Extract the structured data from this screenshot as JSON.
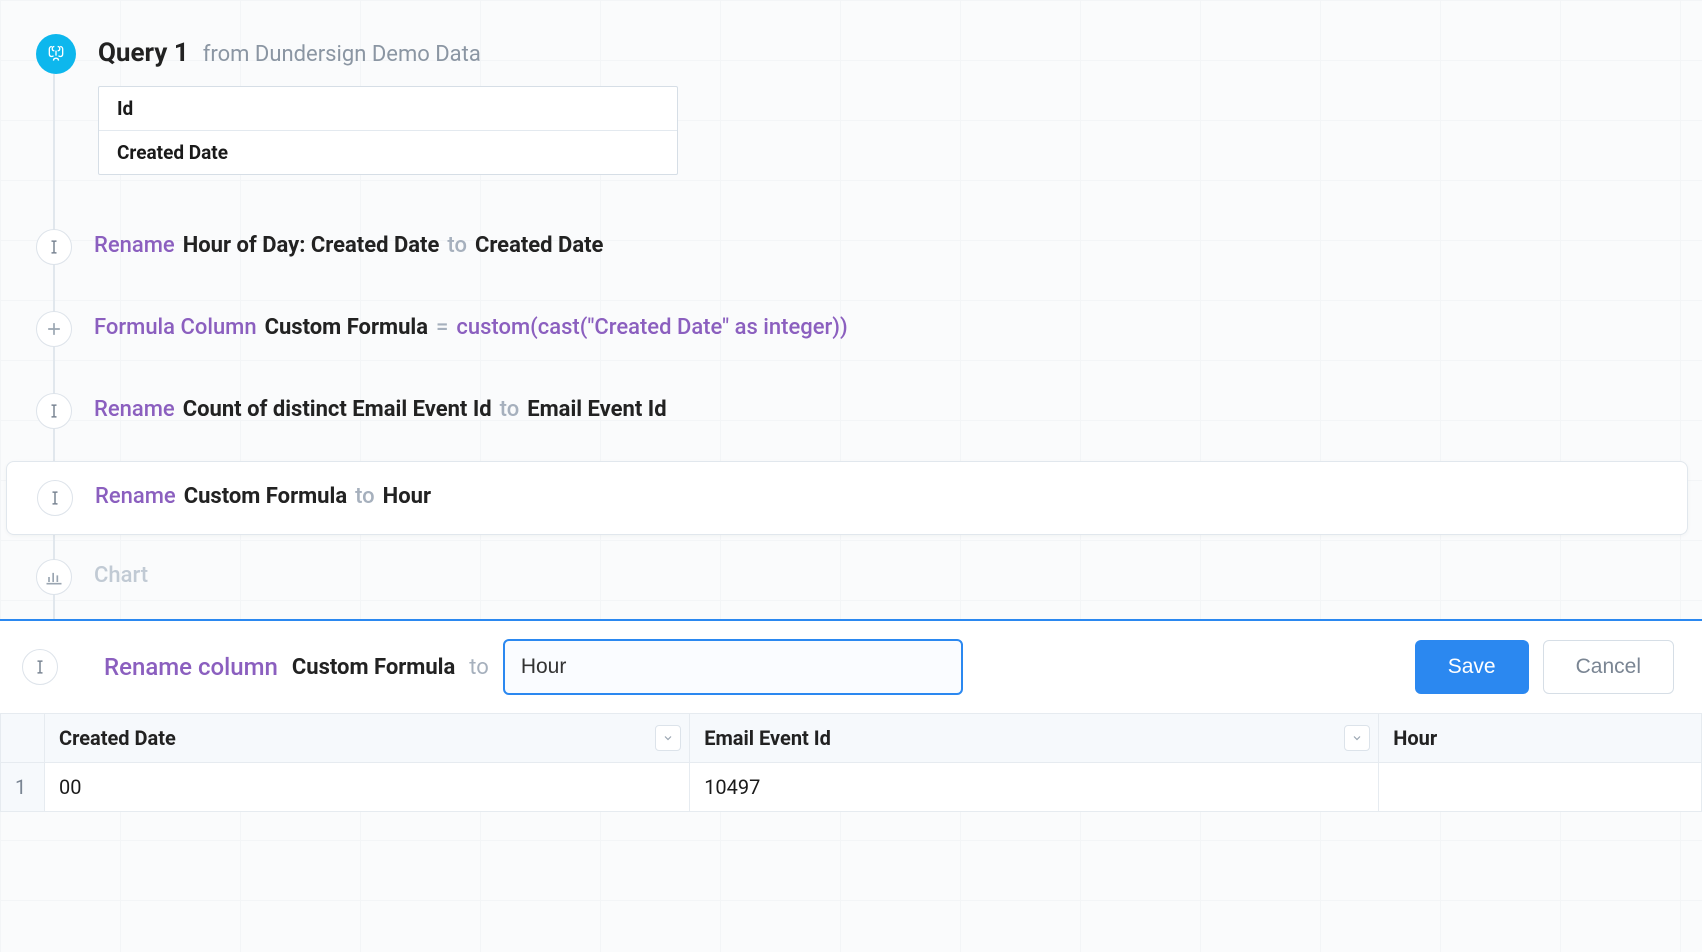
{
  "header": {
    "title": "Query 1",
    "source_label": "from Dundersign Demo Data",
    "columns": [
      "Id",
      "Created Date"
    ]
  },
  "steps": [
    {
      "kind": "rename",
      "label": "Rename",
      "from": "Hour of Day: Created Date",
      "joiner": "to",
      "to": "Created Date"
    },
    {
      "kind": "formula",
      "label": "Formula Column",
      "col_name": "Custom Formula",
      "eq": "=",
      "expr": "custom(cast(\"Created Date\" as integer))"
    },
    {
      "kind": "rename",
      "label": "Rename",
      "from": "Count of distinct Email Event Id",
      "joiner": "to",
      "to": "Email Event Id"
    },
    {
      "kind": "rename",
      "label": "Rename",
      "from": "Custom Formula",
      "joiner": "to",
      "to": "Hour",
      "active": true
    },
    {
      "kind": "chart",
      "label": "Chart"
    }
  ],
  "editor": {
    "title": "Rename column",
    "col": "Custom Formula",
    "joiner": "to",
    "value": "Hour",
    "save": "Save",
    "cancel": "Cancel"
  },
  "results": {
    "headers": [
      "Created Date",
      "Email Event Id",
      "Hour"
    ],
    "rows": [
      {
        "n": "1",
        "created_date": "00",
        "email_event_id": "10497",
        "hour": ""
      }
    ]
  }
}
